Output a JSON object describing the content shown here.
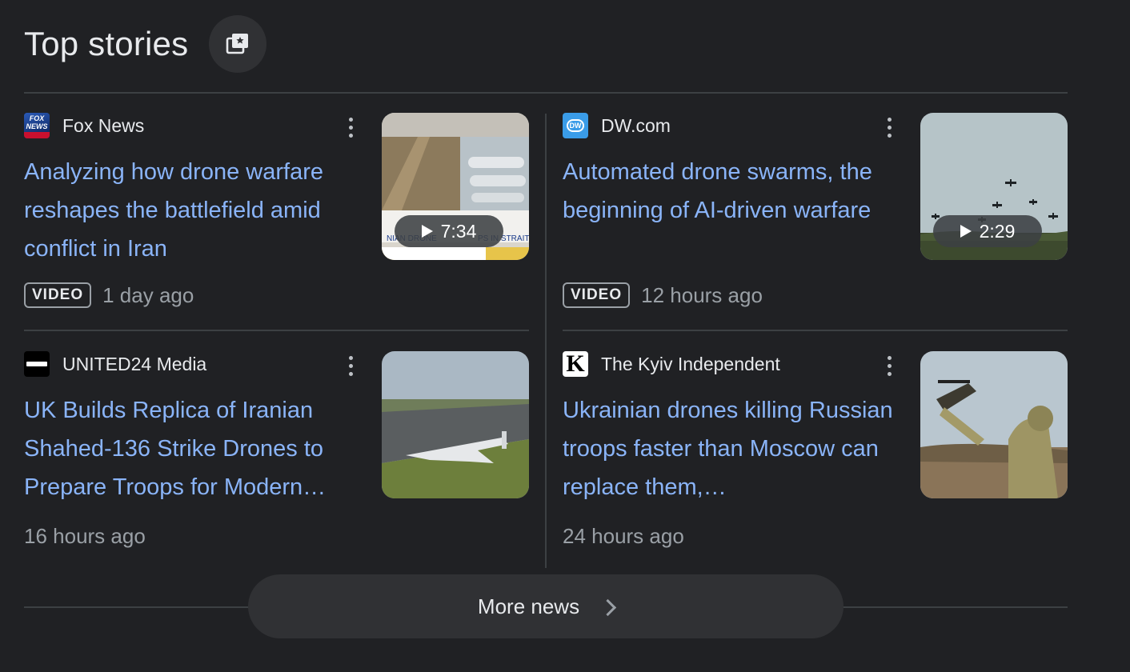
{
  "header": {
    "title": "Top stories"
  },
  "stories": [
    {
      "source": "Fox News",
      "title": "Analyzing how drone warfare reshapes the battlefield amid conflict in Iran",
      "badge": "VIDEO",
      "time": "1 day ago",
      "duration": "7:34"
    },
    {
      "source": "DW.com",
      "title": "Automated drone swarms, the beginning of AI-driven warfare",
      "badge": "VIDEO",
      "time": "12 hours ago",
      "duration": "2:29"
    },
    {
      "source": "UNITED24 Media",
      "title": "UK Builds Replica of Iranian Shahed-136 Strike Drones to Prepare Troops for Modern…",
      "time": "16 hours ago"
    },
    {
      "source": "The Kyiv Independent",
      "title": "Ukrainian drones killing Russian troops faster than Moscow can replace them,…",
      "time": "24 hours ago"
    }
  ],
  "footer": {
    "more_label": "More news"
  },
  "colors": {
    "background": "#202124",
    "link": "#8ab4f8",
    "text": "#e8eaed",
    "muted": "#9aa0a6"
  }
}
